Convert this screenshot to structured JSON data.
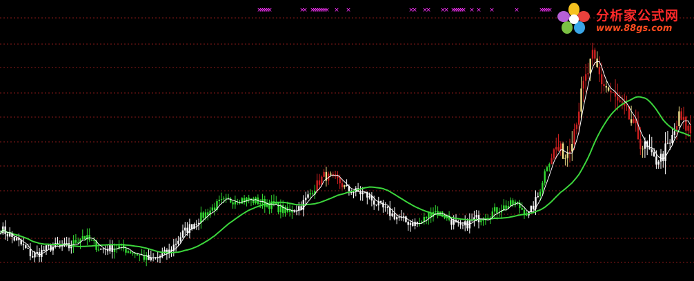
{
  "watermark": {
    "title": "分析家公式网",
    "url": "www.88gs.com"
  },
  "colors": {
    "background": "#000000",
    "grid": "#8b1a1a",
    "ma_long": "#3cd63c",
    "ma_short": "#ffffff",
    "candle_green": "#33dd33",
    "candle_white": "#ffffff",
    "candle_red": "#cc1f1f",
    "candle_yellow": "#f2e08a",
    "signal": "#ff33ff"
  },
  "chart_data": {
    "type": "candlestick",
    "title": "",
    "xlabel": "",
    "ylabel": "",
    "grid": true,
    "ylim": [
      0,
      100
    ],
    "signal_marks": "×",
    "signal_x": [
      376,
      379,
      382,
      385,
      388,
      391,
      438,
      442,
      453,
      456,
      459,
      462,
      465,
      468,
      471,
      474,
      488,
      505,
      596,
      601,
      616,
      621,
      642,
      647,
      657,
      660,
      663,
      666,
      669,
      672,
      684,
      694,
      713,
      749,
      785,
      788,
      791,
      794,
      797
    ],
    "segments": [
      {
        "from": 0,
        "to": 31,
        "color": "white"
      },
      {
        "from": 32,
        "to": 43,
        "color": "green"
      },
      {
        "from": 44,
        "to": 49,
        "color": "white"
      },
      {
        "from": 50,
        "to": 64,
        "color": "green"
      },
      {
        "from": 65,
        "to": 87,
        "color": "white"
      },
      {
        "from": 88,
        "to": 128,
        "color": "green"
      },
      {
        "from": 129,
        "to": 135,
        "color": "white"
      },
      {
        "from": 136,
        "to": 138,
        "color": "green"
      },
      {
        "from": 139,
        "to": 151,
        "color": "red"
      },
      {
        "from": 152,
        "to": 183,
        "color": "white"
      },
      {
        "from": 184,
        "to": 197,
        "color": "green"
      },
      {
        "from": 198,
        "to": 210,
        "color": "white"
      },
      {
        "from": 211,
        "to": 231,
        "color": "green"
      },
      {
        "from": 232,
        "to": 236,
        "color": "white"
      },
      {
        "from": 237,
        "to": 241,
        "color": "green"
      },
      {
        "from": 242,
        "to": 250,
        "color": "red"
      },
      {
        "from": 251,
        "to": 265,
        "color": "red"
      },
      {
        "from": 266,
        "to": 282,
        "color": "red"
      },
      {
        "from": 283,
        "to": 296,
        "color": "white"
      },
      {
        "from": 297,
        "to": 303,
        "color": "red"
      }
    ],
    "key_levels": [
      [
        0,
        18
      ],
      [
        8,
        12
      ],
      [
        14,
        6
      ],
      [
        22,
        10
      ],
      [
        30,
        10
      ],
      [
        36,
        15
      ],
      [
        44,
        9
      ],
      [
        52,
        10
      ],
      [
        60,
        7
      ],
      [
        66,
        4
      ],
      [
        74,
        8
      ],
      [
        80,
        16
      ],
      [
        88,
        23
      ],
      [
        96,
        29
      ],
      [
        104,
        31
      ],
      [
        112,
        30
      ],
      [
        120,
        28
      ],
      [
        126,
        25
      ],
      [
        132,
        28
      ],
      [
        138,
        36
      ],
      [
        142,
        41
      ],
      [
        148,
        39
      ],
      [
        152,
        35
      ],
      [
        160,
        33
      ],
      [
        166,
        28
      ],
      [
        172,
        24
      ],
      [
        178,
        21
      ],
      [
        184,
        20
      ],
      [
        190,
        26
      ],
      [
        196,
        23
      ],
      [
        202,
        18
      ],
      [
        208,
        22
      ],
      [
        214,
        24
      ],
      [
        220,
        27
      ],
      [
        226,
        29
      ],
      [
        232,
        24
      ],
      [
        236,
        32
      ],
      [
        240,
        46
      ],
      [
        244,
        53
      ],
      [
        248,
        49
      ],
      [
        252,
        62
      ],
      [
        256,
        80
      ],
      [
        260,
        92
      ],
      [
        264,
        82
      ],
      [
        270,
        74
      ],
      [
        276,
        66
      ],
      [
        282,
        54
      ],
      [
        288,
        47
      ],
      [
        294,
        54
      ],
      [
        298,
        66
      ],
      [
        303,
        60
      ]
    ],
    "series": [
      {
        "name": "",
        "type": "ma",
        "period": 30,
        "color": "#3cd63c"
      },
      {
        "name": "",
        "type": "ma",
        "period": 5,
        "color": "#ffffff"
      }
    ]
  }
}
